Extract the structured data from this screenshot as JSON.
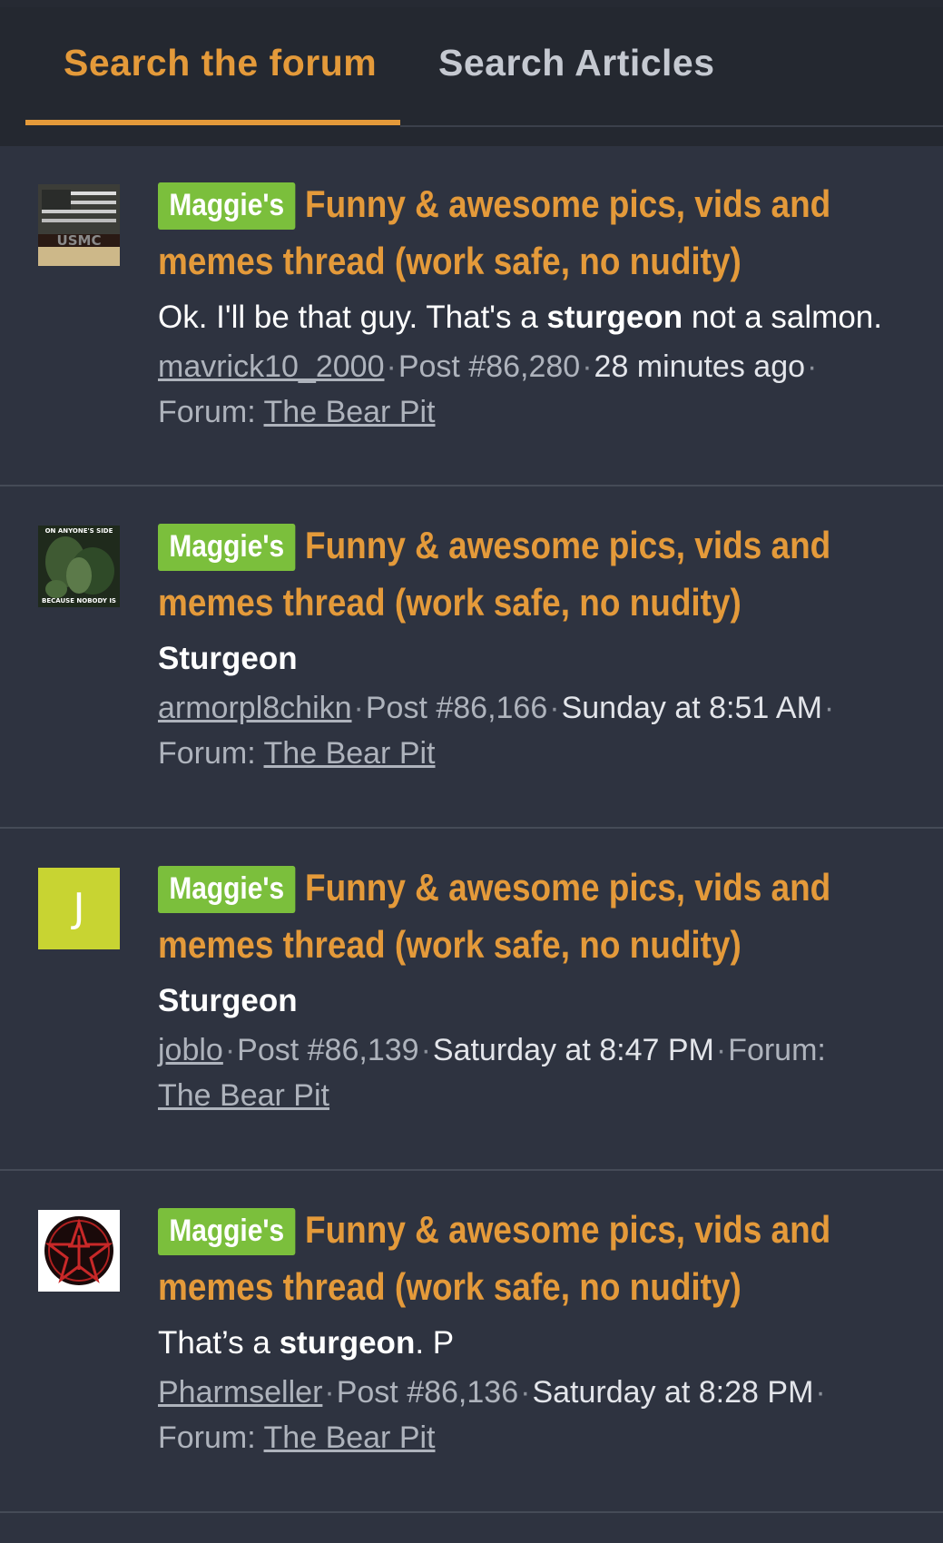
{
  "tabs": {
    "forum": "Search the forum",
    "articles": "Search Articles"
  },
  "results": [
    {
      "prefix": "Maggie's",
      "title_line1": "Funny & awesome pics, vids and",
      "title_line2": "memes thread (work safe, no nudity)",
      "snippet_pre": "Ok. I'll be that guy. That's a ",
      "snippet_bold": "sturgeon",
      "snippet_post": " not a salmon.",
      "author": "mavrick10_2000",
      "post": "Post #86,280",
      "time": "28 minutes ago",
      "forum_label": "Forum:",
      "forum": "The Bear Pit",
      "avatar_text": "USMC"
    },
    {
      "prefix": "Maggie's",
      "title_line1": "Funny & awesome pics, vids and",
      "title_line2": "memes thread (work safe, no nudity)",
      "snippet_pre": "",
      "snippet_bold": "Sturgeon",
      "snippet_post": "",
      "author": "armorpl8chikn",
      "post": "Post #86,166",
      "time": "Sunday at 8:51 AM",
      "forum_label": "Forum:",
      "forum": "The Bear Pit",
      "avatar_text_top": "ON ANYONE'S SIDE",
      "avatar_text_bottom": "BECAUSE NOBODY IS"
    },
    {
      "prefix": "Maggie's",
      "title_line1": "Funny & awesome pics, vids and",
      "title_line2": "memes thread (work safe, no nudity)",
      "snippet_pre": "",
      "snippet_bold": "Sturgeon",
      "snippet_post": "",
      "author": "joblo",
      "post": "Post #86,139",
      "time": "Saturday at 8:47 PM",
      "forum_label": "Forum:",
      "forum": "The Bear Pit",
      "avatar_letter": "J"
    },
    {
      "prefix": "Maggie's",
      "title_line1": "Funny & awesome pics, vids and",
      "title_line2": "memes thread (work safe, no nudity)",
      "snippet_pre": "That’s a ",
      "snippet_bold": "sturgeon",
      "snippet_post": ". P",
      "author": "Pharmseller",
      "post": "Post #86,136",
      "time": "Saturday at 8:28 PM",
      "forum_label": "Forum:",
      "forum": "The Bear Pit"
    }
  ],
  "colors": {
    "accent": "#e49a3a",
    "badge": "#7bbf3c",
    "background": "#2e3340",
    "avatar_j": "#c8d432"
  }
}
